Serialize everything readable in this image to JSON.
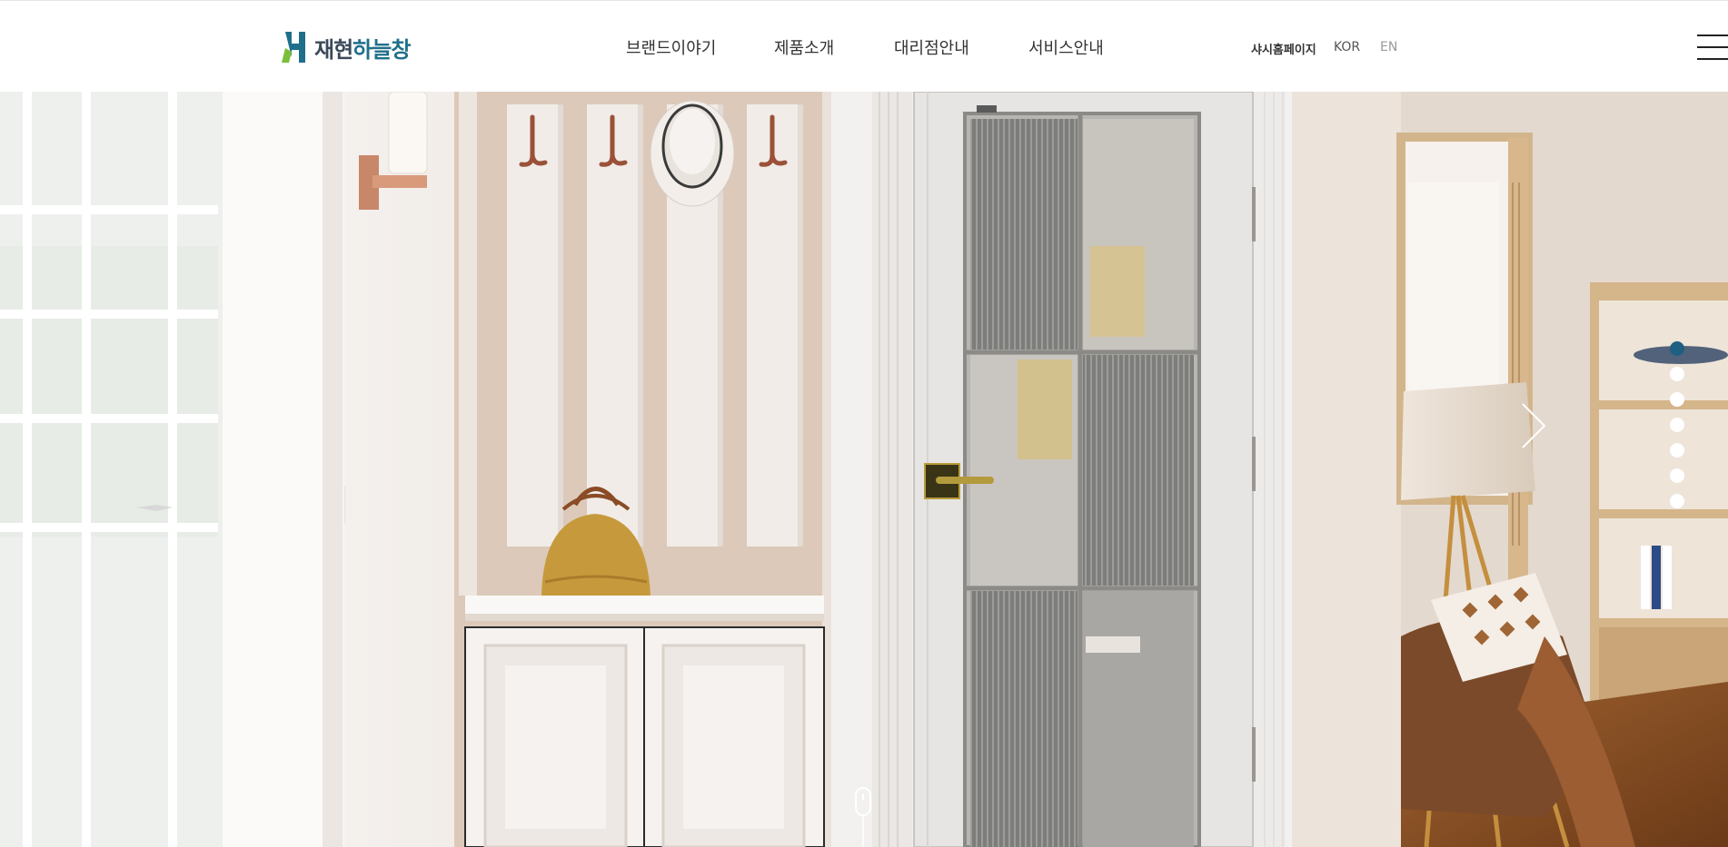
{
  "brand": {
    "name_part1": "재현",
    "name_part2": "하늘창",
    "logo_icon": "h-logo-icon"
  },
  "nav": {
    "items": [
      {
        "label": "브랜드이야기"
      },
      {
        "label": "제품소개"
      },
      {
        "label": "대리점안내"
      },
      {
        "label": "서비스안내"
      }
    ]
  },
  "util": {
    "sash_label": "샤시홈페이지",
    "kor_label": "KOR",
    "en_label": "EN"
  },
  "menu_icon": "hamburger-menu-icon",
  "slider": {
    "total_slides": 7,
    "active_index": 0,
    "next_icon": "chevron-right-icon",
    "scroll_icon": "scroll-mouse-icon"
  },
  "colors": {
    "accent": "#1f5f82",
    "logo_green": "#7bbf3a",
    "logo_blue": "#1f6f8b",
    "text_dark": "#333333"
  }
}
